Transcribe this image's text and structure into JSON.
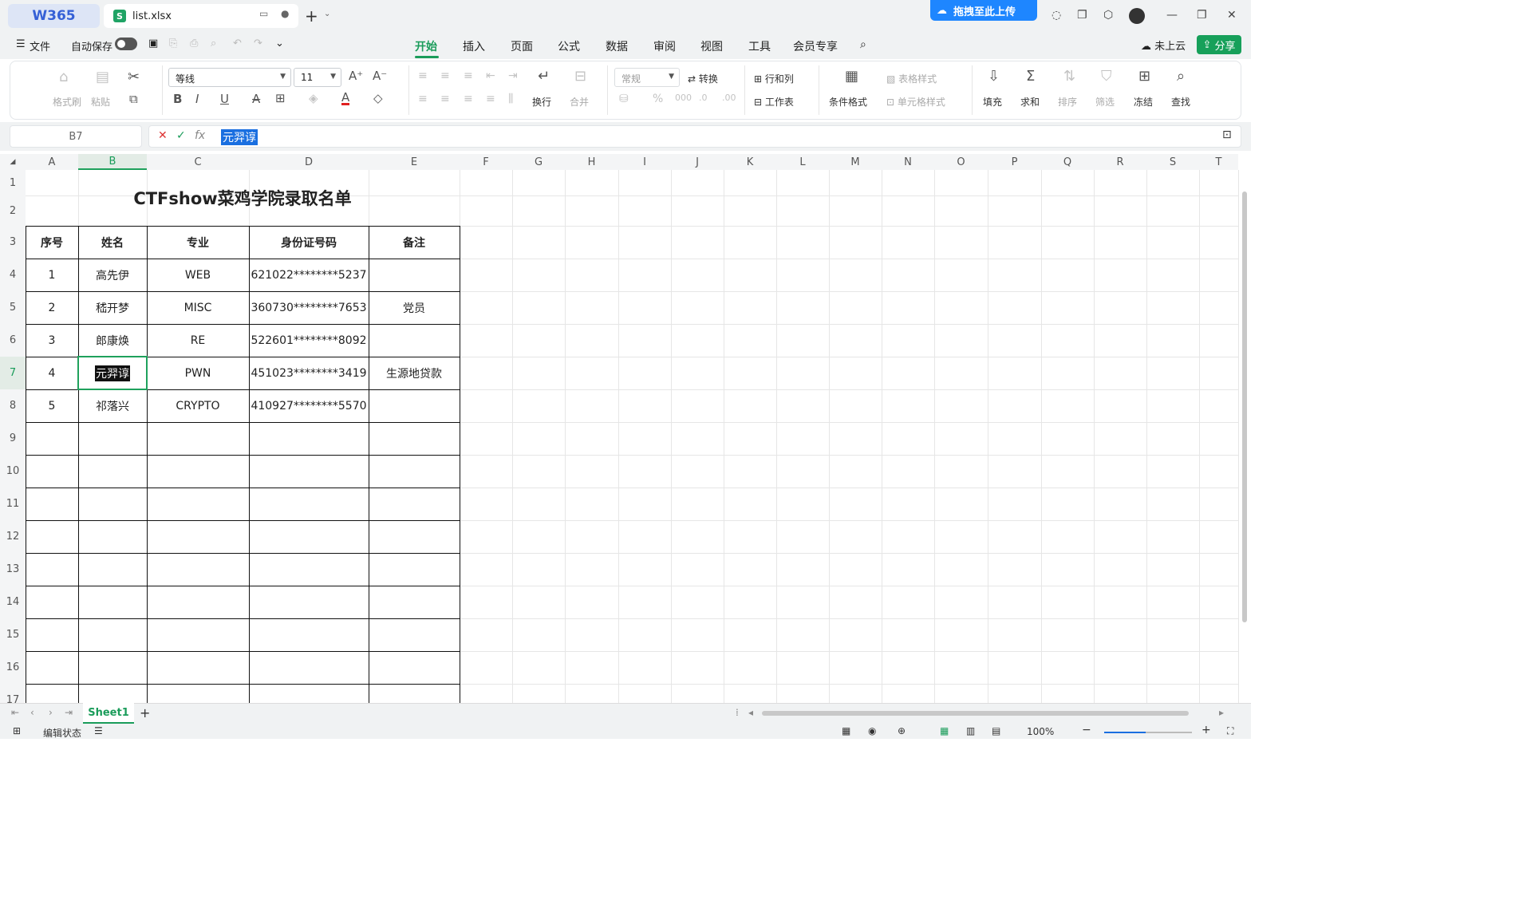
{
  "titlebar": {
    "home": "W365",
    "file": "list.xlsx",
    "upload": "拖拽至此上传"
  },
  "menubar": {
    "file": "文件",
    "autosave": "自动保存",
    "ribbon_tabs": [
      "开始",
      "插入",
      "页面",
      "公式",
      "数据",
      "审阅",
      "视图",
      "工具",
      "会员专享"
    ],
    "cloud": "未上云",
    "share": "分享"
  },
  "ribbon": {
    "format_painter": "格式刷",
    "paste": "粘贴",
    "font": "等线",
    "size": "11",
    "wrap": "换行",
    "merge": "合并",
    "num_format": "常规",
    "convert": "转换",
    "rowcol": "行和列",
    "sheet": "工作表",
    "cond_format": "条件格式",
    "table_style": "表格样式",
    "cell_style": "单元格样式",
    "fill": "填充",
    "sum": "求和",
    "sort": "排序",
    "filter": "筛选",
    "freeze": "冻结",
    "find": "查找"
  },
  "formula": {
    "namebox": "B7",
    "value": "元羿谆"
  },
  "columns": [
    "A",
    "B",
    "C",
    "D",
    "E",
    "F",
    "G",
    "H",
    "I",
    "J",
    "K",
    "L",
    "M",
    "N",
    "O",
    "P",
    "Q",
    "R",
    "S",
    "T"
  ],
  "rows": [
    "1",
    "2",
    "3",
    "4",
    "5",
    "6",
    "7",
    "8",
    "9",
    "10",
    "11",
    "12",
    "13",
    "14",
    "15",
    "16",
    "17"
  ],
  "sheet": {
    "title": "CTFshow菜鸡学院录取名单",
    "headers": [
      "序号",
      "姓名",
      "专业",
      "身份证号码",
      "备注"
    ],
    "records": [
      [
        "1",
        "高先伊",
        "WEB",
        "621022********5237",
        ""
      ],
      [
        "2",
        "嵇开梦",
        "MISC",
        "360730********7653",
        "党员"
      ],
      [
        "3",
        "郎康焕",
        "RE",
        "522601********8092",
        ""
      ],
      [
        "4",
        "元羿谆",
        "PWN",
        "451023********3419",
        "生源地贷款"
      ],
      [
        "5",
        "祁落兴",
        "CRYPTO",
        "410927********5570",
        ""
      ]
    ]
  },
  "sheettab": "Sheet1",
  "status": {
    "mode": "编辑状态",
    "zoom": "100%"
  }
}
